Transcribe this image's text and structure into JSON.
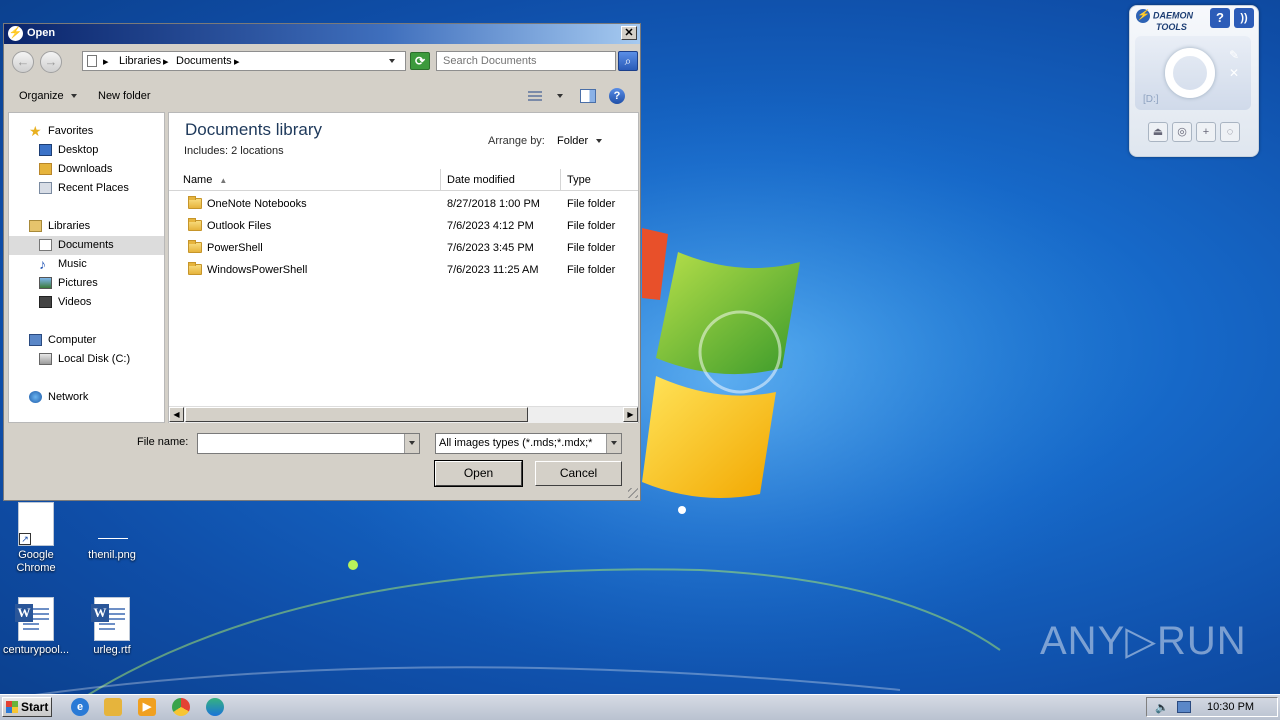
{
  "desktop": {
    "icons": [
      {
        "label": "Google\nChrome"
      },
      {
        "label": "thenil.png"
      },
      {
        "label": "centurypool..."
      },
      {
        "label": "urleg.rtf"
      }
    ],
    "watermark": "ANY▷RUN"
  },
  "daemon": {
    "logo_line1": "DAEMON",
    "logo_line2": "TOOLS",
    "help": "?",
    "drive_label": "[D:]"
  },
  "dialog": {
    "title": "Open",
    "close": "✕",
    "breadcrumb": [
      "Libraries",
      "Documents"
    ],
    "search_placeholder": "Search Documents",
    "toolbar": {
      "organize": "Organize",
      "new_folder": "New folder"
    },
    "nav": {
      "favorites": "Favorites",
      "desktop": "Desktop",
      "downloads": "Downloads",
      "recent": "Recent Places",
      "libraries": "Libraries",
      "documents": "Documents",
      "music": "Music",
      "pictures": "Pictures",
      "videos": "Videos",
      "computer": "Computer",
      "local_disk": "Local Disk (C:)",
      "network": "Network"
    },
    "library_title": "Documents library",
    "library_sub": "Includes:  2 locations",
    "arrange_label": "Arrange by:",
    "arrange_value": "Folder",
    "columns": {
      "name": "Name",
      "date": "Date modified",
      "type": "Type"
    },
    "files": [
      {
        "name": "OneNote Notebooks",
        "date": "8/27/2018 1:00 PM",
        "type": "File folder"
      },
      {
        "name": "Outlook Files",
        "date": "7/6/2023 4:12 PM",
        "type": "File folder"
      },
      {
        "name": "PowerShell",
        "date": "7/6/2023 3:45 PM",
        "type": "File folder"
      },
      {
        "name": "WindowsPowerShell",
        "date": "7/6/2023 11:25 AM",
        "type": "File folder"
      }
    ],
    "file_name_label": "File name:",
    "file_name_value": "",
    "file_type": "All images types (*.mds;*.mdx;*",
    "open_button": "Open",
    "cancel_button": "Cancel"
  },
  "taskbar": {
    "start": "Start",
    "clock": "10:30 PM"
  }
}
